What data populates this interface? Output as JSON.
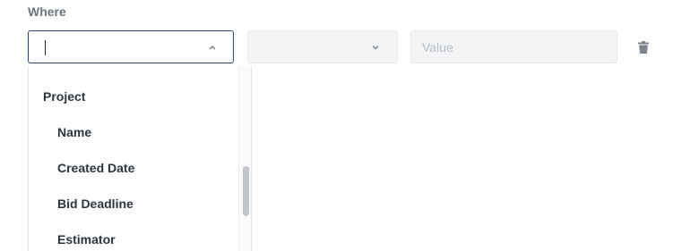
{
  "filter": {
    "label": "Where",
    "value_placeholder": "Value",
    "field_value": "",
    "operator_value": ""
  },
  "dropdown": {
    "group": "Project",
    "options": [
      "Name",
      "Created Date",
      "Bid Deadline",
      "Estimator"
    ]
  },
  "icons": {
    "field_chevron": "chevron-up-icon",
    "operator_chevron": "chevron-down-icon",
    "delete": "trash-icon"
  },
  "colors": {
    "focus_border": "#2b3f8f",
    "disabled_bg": "#f3f4f5",
    "label_text": "#6b7480",
    "item_text": "#2c3440"
  }
}
